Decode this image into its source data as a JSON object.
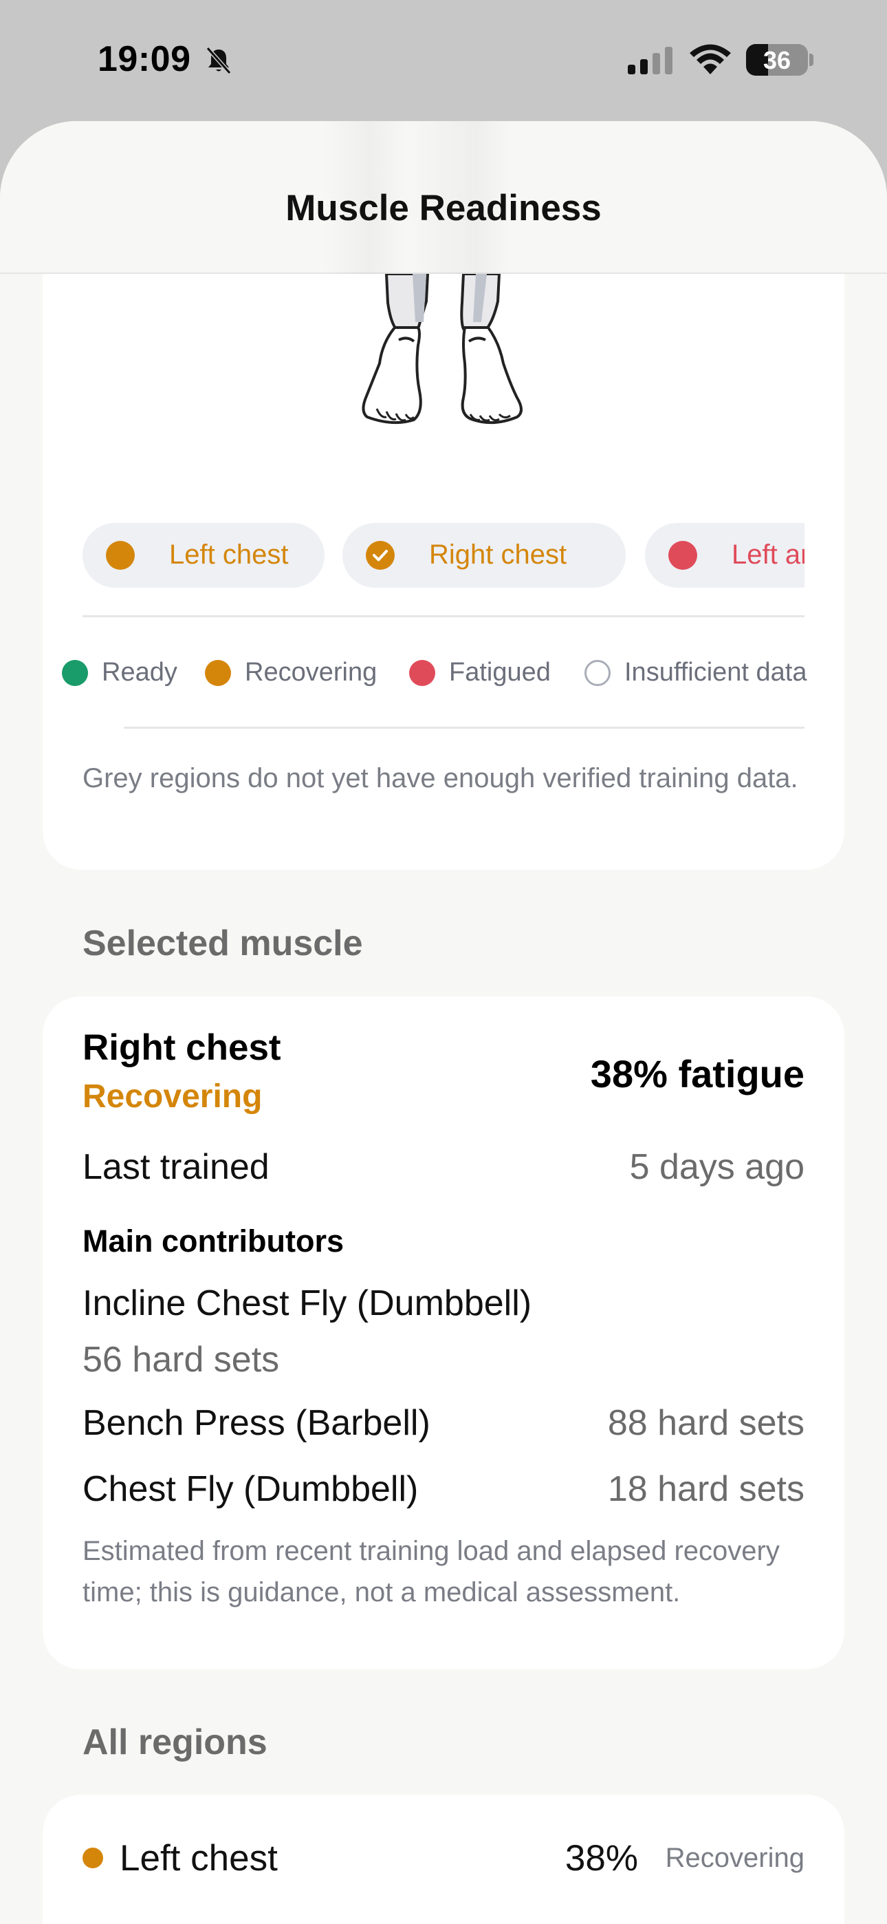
{
  "status_bar": {
    "time": "19:09",
    "battery": "36",
    "icons": [
      "bell-slash-icon",
      "cellular-signal-icon",
      "wifi-icon",
      "battery-icon"
    ]
  },
  "nav": {
    "title": "Muscle Readiness"
  },
  "colors": {
    "ready": "#1a9b6a",
    "recovering": "#d4860b",
    "fatigued": "#e04b5a",
    "insufficient": "#a9adb8"
  },
  "chips": [
    {
      "label": "Left chest",
      "state": "recovering",
      "selected": false
    },
    {
      "label": "Right chest",
      "state": "recovering",
      "selected": true
    },
    {
      "label": "Left ant",
      "state": "fatigued",
      "selected": false
    }
  ],
  "legend": [
    {
      "label": "Ready",
      "state": "ready"
    },
    {
      "label": "Recovering",
      "state": "recovering"
    },
    {
      "label": "Fatigued",
      "state": "fatigued"
    },
    {
      "label": "Insufficient data",
      "state": "insufficient"
    }
  ],
  "figure_note": "Grey regions do not yet have enough verified training data.",
  "selected_section": {
    "heading": "Selected muscle",
    "name": "Right chest",
    "status": "Recovering",
    "fatigue": "38% fatigue",
    "last_trained_label": "Last trained",
    "last_trained_value": "5 days ago",
    "contributors_heading": "Main contributors",
    "contributors": [
      {
        "exercise": "Incline Chest Fly (Dumbbell)",
        "sets": "56 hard sets"
      },
      {
        "exercise": "Bench Press (Barbell)",
        "sets": "88 hard sets"
      },
      {
        "exercise": "Chest Fly (Dumbbell)",
        "sets": "18 hard sets"
      }
    ],
    "disclaimer": "Estimated from recent training load and elapsed recovery time; this is guidance, not a medical assessment."
  },
  "all_regions": {
    "heading": "All regions",
    "items": [
      {
        "name": "Left chest",
        "percent": "38%",
        "status": "Recovering",
        "state": "recovering"
      }
    ]
  }
}
